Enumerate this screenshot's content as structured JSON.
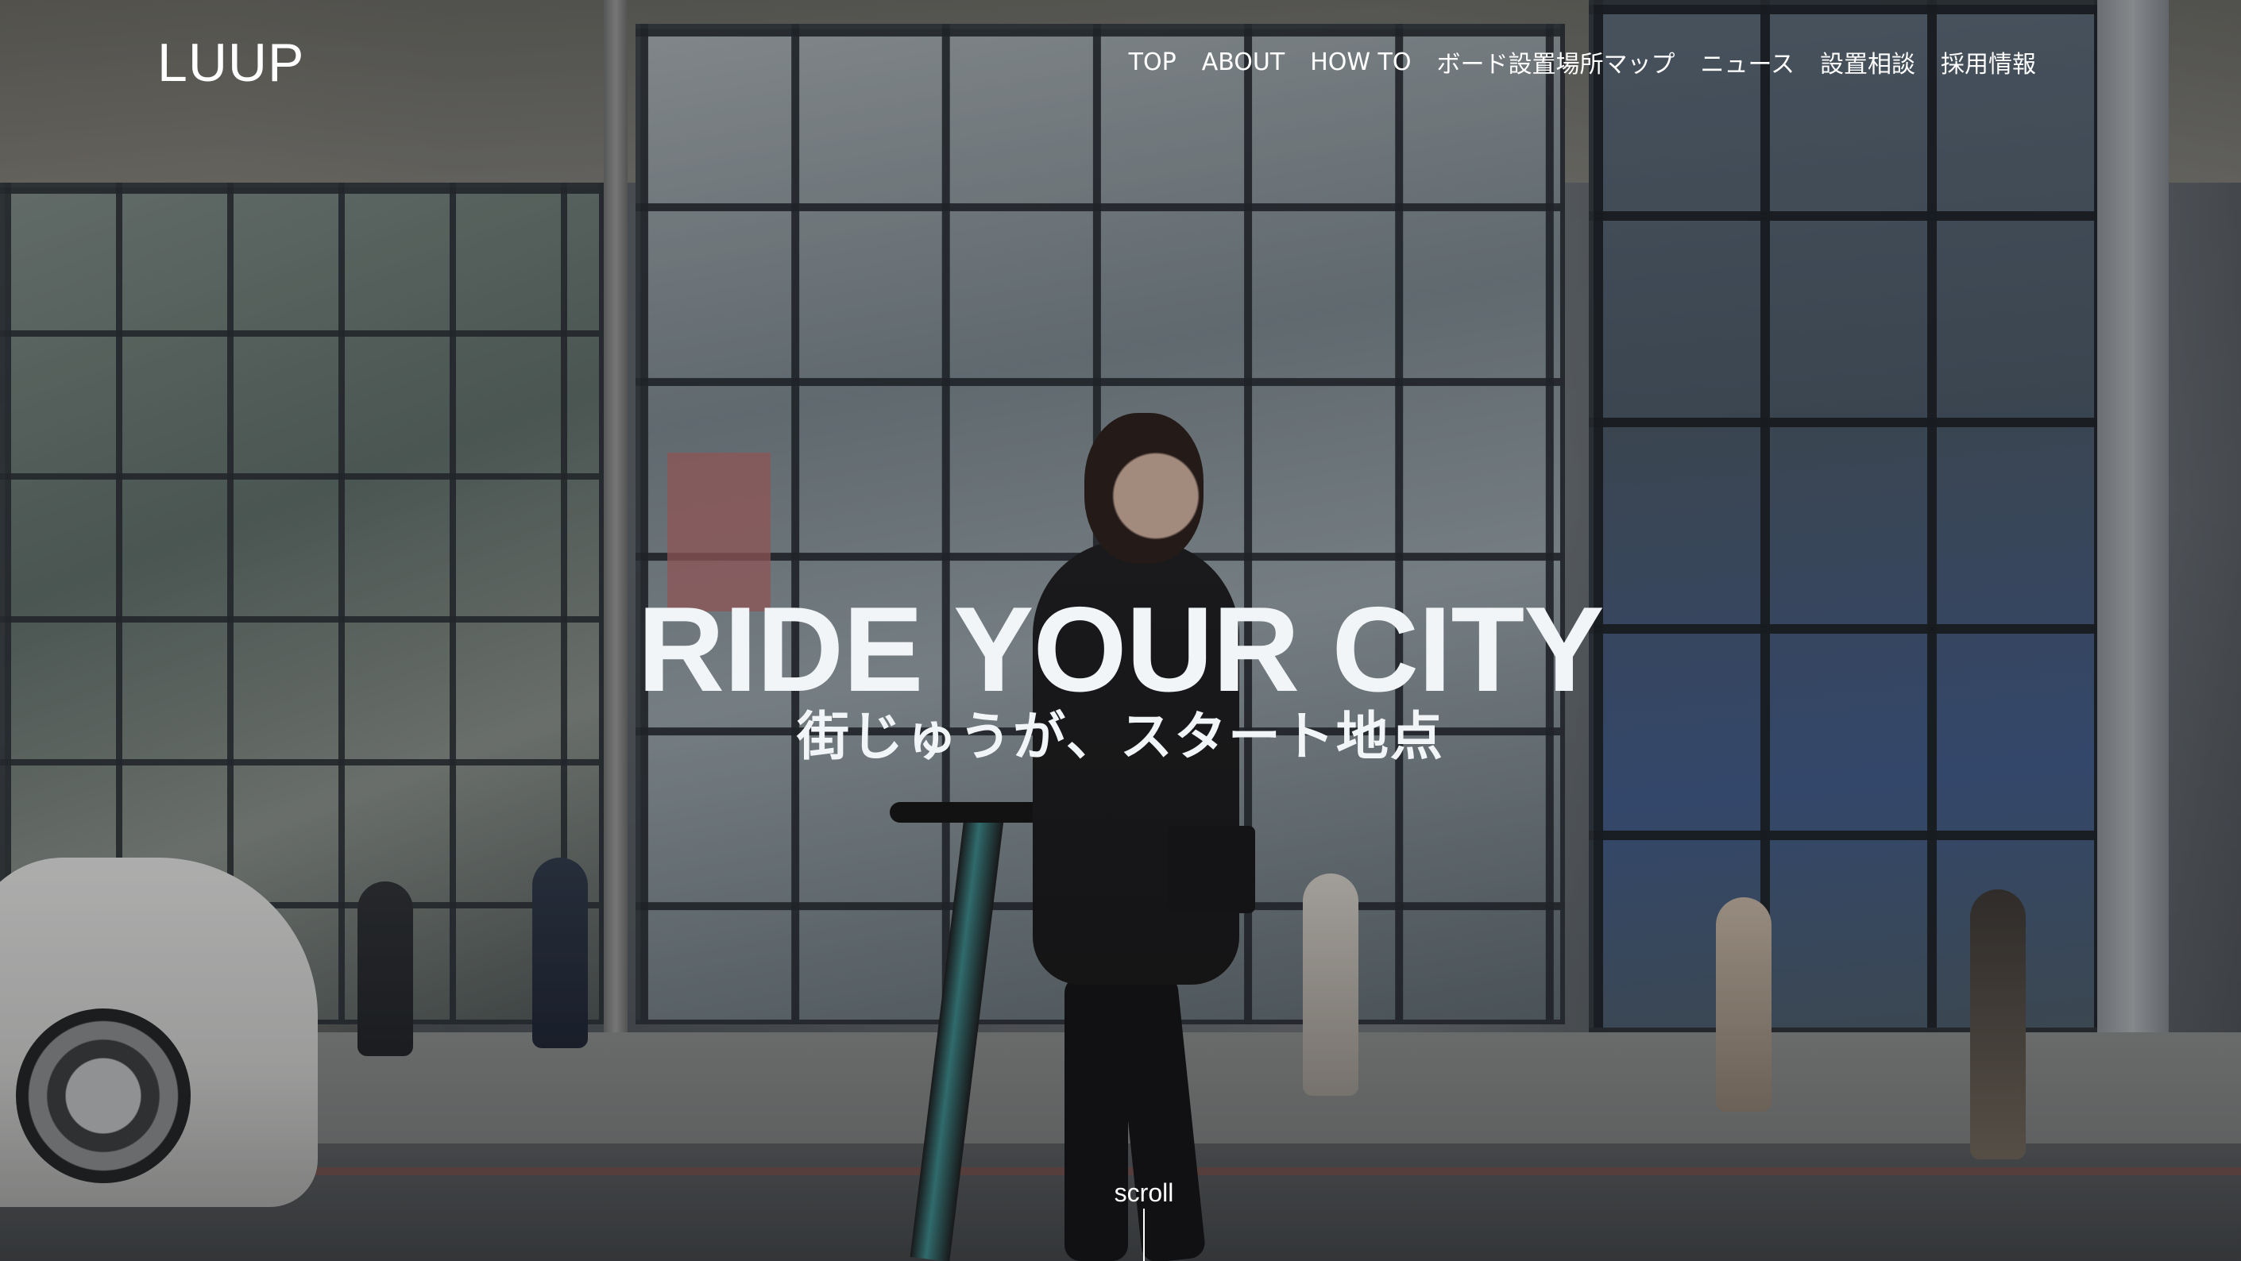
{
  "brand": {
    "logo_text": "LUUP"
  },
  "nav": {
    "items": [
      {
        "label": "TOP"
      },
      {
        "label": "ABOUT"
      },
      {
        "label": "HOW TO"
      },
      {
        "label": "ボード設置場所マップ"
      },
      {
        "label": "ニュース"
      },
      {
        "label": "設置相談"
      },
      {
        "label": "採用情報"
      }
    ]
  },
  "hero": {
    "headline": "RIDE YOUR CITY",
    "subheadline": "街じゅうが、スタート地点",
    "scroll_label": "scroll"
  },
  "colors": {
    "text": "#ffffff",
    "headline": "#f2f5f8"
  }
}
